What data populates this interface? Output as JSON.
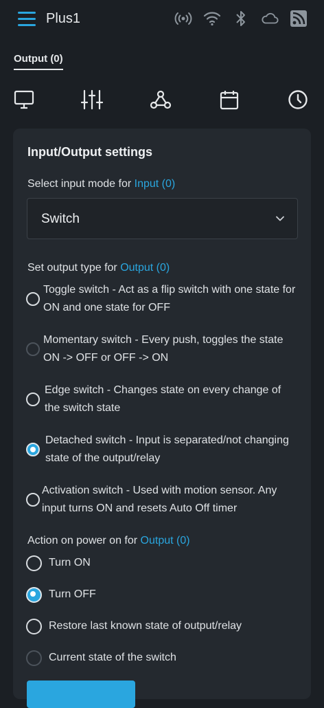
{
  "header": {
    "app_title": "Plus1",
    "icons": [
      "menu-icon",
      "broadcast-icon",
      "wifi-icon",
      "bluetooth-icon",
      "cloud-icon",
      "rss-icon"
    ]
  },
  "tabs": {
    "output_label": "Output (0)"
  },
  "section_icons": [
    "monitor-icon",
    "sliders-icon",
    "webhook-icon",
    "calendar-icon",
    "clock-icon"
  ],
  "card": {
    "title": "Input/Output settings",
    "input_mode_prefix": "Select input mode for ",
    "input_mode_link": "Input (0)",
    "input_mode_value": "Switch",
    "output_type_prefix": "Set output type for ",
    "output_type_link": "Output (0)",
    "output_types": [
      {
        "label": "Toggle switch - Act as a flip switch with one state for ON and one state for OFF",
        "selected": false
      },
      {
        "label": "Momentary switch - Every push, toggles the state ON -> OFF or OFF -> ON",
        "selected": false
      },
      {
        "label": "Edge switch - Changes state on every change of the switch state",
        "selected": false
      },
      {
        "label": "Detached switch - Input is separated/not changing state of the output/relay",
        "selected": true
      },
      {
        "label": "Activation switch - Used with motion sensor. Any input turns ON and resets Auto Off timer",
        "selected": false
      }
    ],
    "power_on_prefix": "Action on power on for ",
    "power_on_link": "Output (0)",
    "power_on_options": [
      {
        "label": "Turn ON",
        "selected": false
      },
      {
        "label": "Turn OFF",
        "selected": true
      },
      {
        "label": "Restore last known state of output/relay",
        "selected": false
      },
      {
        "label": "Current state of the switch",
        "selected": false
      }
    ]
  },
  "colors": {
    "accent": "#2aa6df",
    "background": "#1b1f24",
    "card": "#24292f"
  }
}
